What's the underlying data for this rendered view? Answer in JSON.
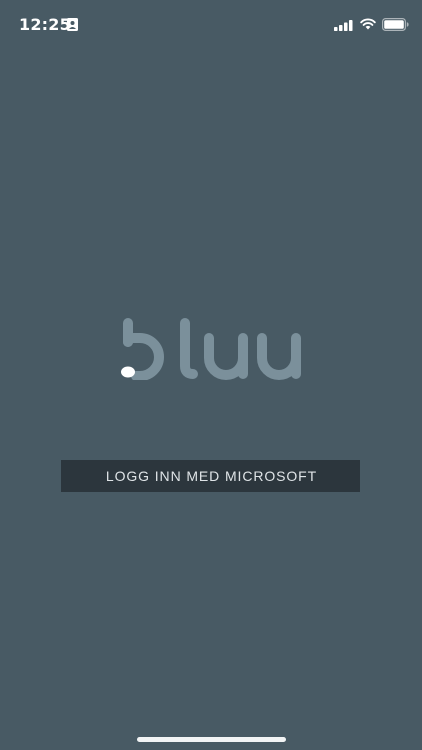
{
  "status_bar": {
    "time": "12:25",
    "icons": [
      "contact-card-icon",
      "cellular-signal-icon",
      "wifi-icon",
      "battery-icon"
    ]
  },
  "logo": {
    "text": "bluu",
    "color": "#7b909b",
    "dot_color": "#ffffff"
  },
  "login": {
    "button_label": "LOGG INN MED MICROSOFT",
    "button_color": "#2c363d"
  },
  "colors": {
    "background": "#485a64"
  }
}
